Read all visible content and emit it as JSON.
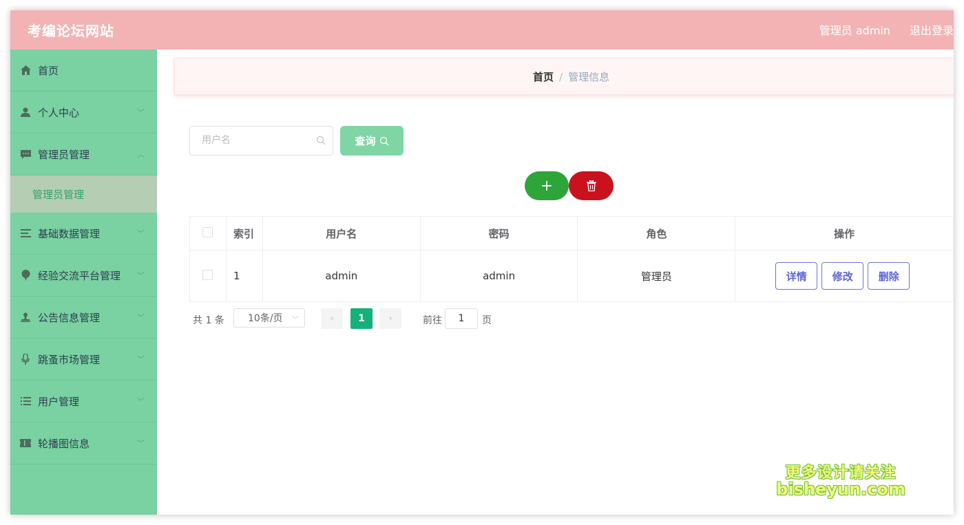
{
  "header": {
    "site_title": "考编论坛网站",
    "admin_label": "管理员 admin",
    "logout": "退出登录"
  },
  "sidebar": {
    "items": [
      {
        "label": "首页",
        "icon": "home-icon"
      },
      {
        "label": "个人中心",
        "icon": "user-icon"
      },
      {
        "label": "管理员管理",
        "icon": "chat-icon"
      },
      {
        "label": "基础数据管理",
        "icon": "list-icon"
      },
      {
        "label": "经验交流平台管理",
        "icon": "balloon-icon"
      },
      {
        "label": "公告信息管理",
        "icon": "stamp-icon"
      },
      {
        "label": "跳蚤市场管理",
        "icon": "mic-icon"
      },
      {
        "label": "用户管理",
        "icon": "menu-list-icon"
      },
      {
        "label": "轮播图信息",
        "icon": "ticket-icon"
      }
    ],
    "subitem": "管理员管理"
  },
  "breadcrumb": {
    "home": "首页",
    "separator": "/",
    "current": "管理信息"
  },
  "search": {
    "placeholder": "用户名",
    "button": "查询"
  },
  "actions": {
    "add": "+"
  },
  "table": {
    "headers": [
      "索引",
      "用户名",
      "密码",
      "角色",
      "操作"
    ],
    "rows": [
      {
        "index": "1",
        "username": "admin",
        "password": "admin",
        "role": "管理员"
      }
    ],
    "ops": {
      "detail": "详情",
      "edit": "修改",
      "delete": "删除"
    }
  },
  "pagination": {
    "total": "共 1 条",
    "page_size": "10条/页",
    "current_page": "1",
    "goto_label": "前往",
    "goto_value": "1",
    "unit": "页"
  },
  "watermark": {
    "line1": "更多设计请关注",
    "line2": "bisheyun.com"
  },
  "colors": {
    "header_bg": "#f3b3b4",
    "sidebar_bg": "#7ad1a1",
    "add_button": "#2ea539",
    "delete_button": "#c9121e",
    "page_active": "#14b17a"
  }
}
